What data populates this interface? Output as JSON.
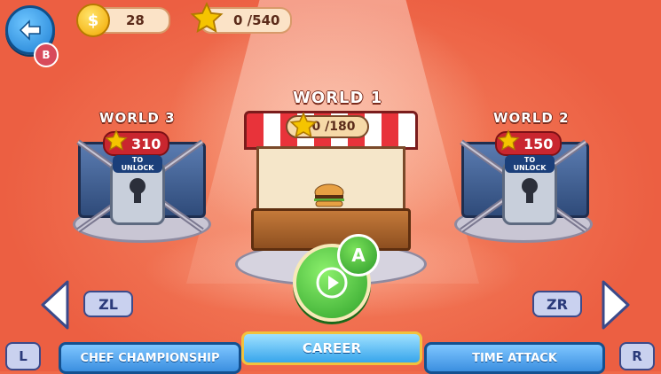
{
  "header": {
    "coins": "28",
    "stars": "0 /540",
    "back_button_label": "B"
  },
  "worlds": [
    {
      "title": "WORLD 3",
      "cost": "310",
      "lock_text": "TO UNLOCK",
      "state": "locked"
    },
    {
      "title": "WORLD 1",
      "progress": "0 /180",
      "state": "unlocked"
    },
    {
      "title": "WORLD 2",
      "cost": "150",
      "lock_text": "TO UNLOCK",
      "state": "locked"
    }
  ],
  "controls": {
    "play_button_key": "A",
    "left_key": "ZL",
    "right_key": "ZR",
    "left_shoulder": "L",
    "right_shoulder": "R"
  },
  "tabs": [
    {
      "label": "CHEF CHAMPIONSHIP",
      "active": false
    },
    {
      "label": "CAREER",
      "active": true
    },
    {
      "label": "TIME ATTACK",
      "active": false
    }
  ],
  "colors": {
    "background": "#f06a4a",
    "tab_blue": "#3b8fe0",
    "play_green": "#2ea22a",
    "price_red": "#c9262f",
    "star_gold": "#f5c400"
  },
  "icons": [
    "back-arrow-icon",
    "coin-icon",
    "star-icon",
    "lock-icon",
    "chain-icon",
    "play-icon",
    "left-arrow-icon",
    "right-arrow-icon"
  ]
}
